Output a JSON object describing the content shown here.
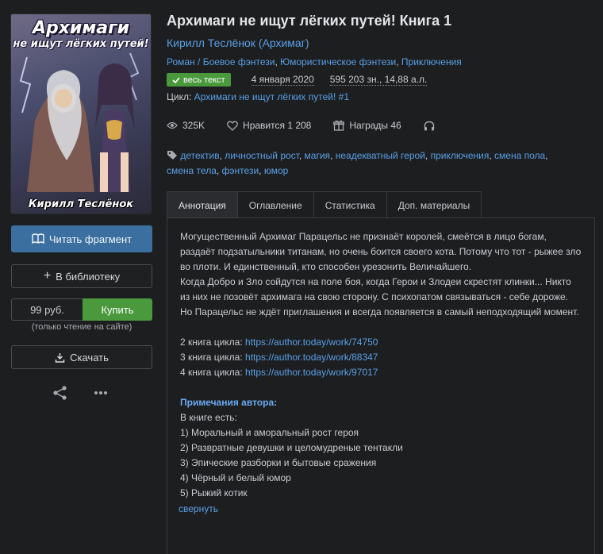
{
  "cover": {
    "title": "Архимаги",
    "subtitle": "не ищут лёгких путей!",
    "author": "Кирилл Теслёнок"
  },
  "actions": {
    "read_fragment": "Читать фрагмент",
    "add_library": "В библиотеку",
    "price": "99 руб.",
    "buy": "Купить",
    "buy_note": "(только чтение на сайте)",
    "download": "Скачать"
  },
  "book": {
    "title": "Архимаги не ищут лёгких путей! Книга 1",
    "author": "Кирилл Теслёнок (Архимаг)",
    "genres": [
      "Роман / Боевое фэнтези",
      "Юмористическое фэнтези",
      "Приключения"
    ],
    "status_badge": "весь текст",
    "date": "4 января 2020",
    "size": "595 203 зн., 14,88 а.л.",
    "cycle_label": "Цикл:",
    "cycle_name": "Архимаги не ищут лёгких путей! #1"
  },
  "stats": {
    "views": "325K",
    "likes": "Нравится 1 208",
    "awards": "Награды 46"
  },
  "tags": [
    "детектив",
    "личностный рост",
    "магия",
    "неадекватный герой",
    "приключения",
    "смена пола",
    "смена тела",
    "фэнтези",
    "юмор"
  ],
  "tabs": [
    "Аннотация",
    "Оглавление",
    "Статистика",
    "Доп. материалы"
  ],
  "annotation": {
    "paragraphs": [
      "Могущественный Архимаг Парацельс не признаёт королей, смеётся в лицо богам, раздаёт подзатыльники титанам, но очень боится своего кота. Потому что тот - рыжее зло во плоти. И единственный, кто способен урезонить Величайшего.",
      "Когда Добро и Зло сойдутся на поле боя, когда Герои и Злодеи скрестят клинки... Никто из них не позовёт архимага на свою сторону. С психопатом связываться - себе дороже.",
      "Но Парацельс не ждёт приглашения и всегда появляется в самый неподходящий момент."
    ],
    "links": [
      {
        "label": "2 книга цикла:",
        "url": "https://author.today/work/74750"
      },
      {
        "label": "3 книга цикла:",
        "url": "https://author.today/work/88347"
      },
      {
        "label": "4 книга цикла:",
        "url": "https://author.today/work/97017"
      }
    ],
    "notes_heading": "Примечания автора:",
    "notes_intro": "В книге есть:",
    "notes": [
      "1) Моральный и аморальный рост героя",
      "2) Развратные девушки и целомудреные тентакли",
      "3) Эпические разборки и бытовые сражения",
      "4) Чёрный и белый юмор",
      "5) Рыжий котик"
    ],
    "collapse": "свернуть"
  },
  "colors": {
    "accent": "#5aa0e6",
    "read_button": "#3b6f9f",
    "buy_button": "#4a9a3d",
    "background": "#1d1e20"
  }
}
